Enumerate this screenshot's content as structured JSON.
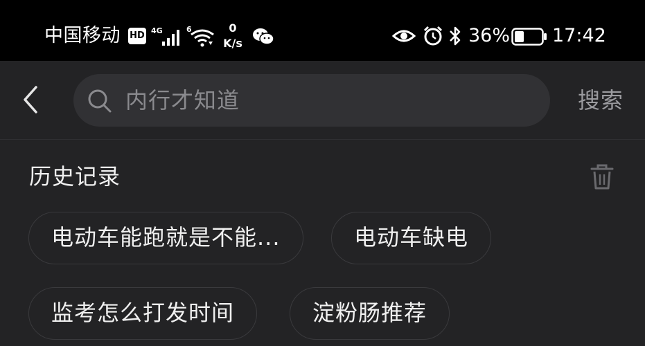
{
  "status_bar": {
    "carrier": "中国移动",
    "hd_label": "HD",
    "net_4g": "4G",
    "net_6": "6",
    "speed_value": "0",
    "speed_unit": "K/s",
    "battery_percent": "36%",
    "battery_level": 0.36,
    "time": "17:42",
    "icons": [
      "signal-icon",
      "wifi-icon",
      "wechat-icon",
      "eye-icon",
      "alarm-icon",
      "bluetooth-icon",
      "battery-icon"
    ]
  },
  "search": {
    "placeholder": "内行才知道",
    "submit_label": "搜索"
  },
  "history": {
    "title": "历史记录",
    "items": [
      "电动车能跑就是不能...",
      "电动车缺电",
      "监考怎么打发时间",
      "淀粉肠推荐"
    ]
  },
  "colors": {
    "background": "#232325",
    "status_bar": "#000000",
    "search_field": "#313134",
    "chip_border": "#3a3a3d",
    "muted_text": "#8a8a8e"
  }
}
